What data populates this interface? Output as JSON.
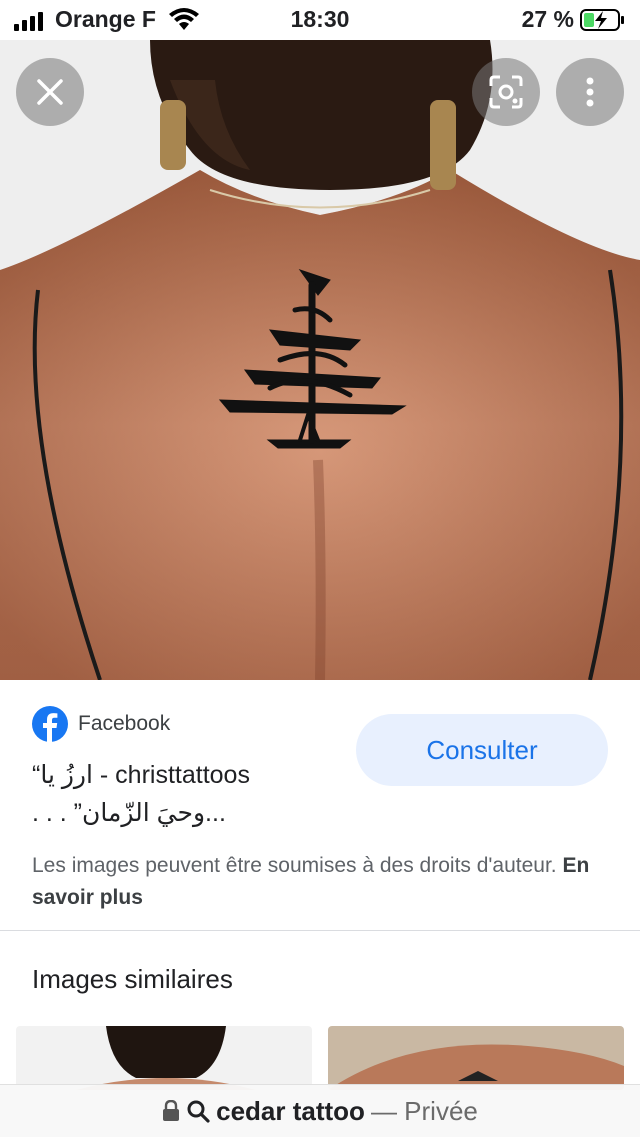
{
  "status_bar": {
    "carrier": "Orange F",
    "time": "18:30",
    "battery_percent": "27 %"
  },
  "viewer": {
    "close_icon": "close-icon",
    "lens_icon": "lens-icon",
    "more_icon": "more-vertical-icon"
  },
  "result": {
    "source": "Facebook",
    "title_line1": "“ارزُ يا - christtattoos",
    "title_line2": ". . . ”وحيَ الزّمان...",
    "consult_label": "Consulter",
    "copyright_text": "Les images peuvent être soumises à des droits d'auteur.",
    "learn_more": "En savoir plus"
  },
  "similar": {
    "heading": "Images similaires"
  },
  "address_bar": {
    "query": "cedar tattoo",
    "mode": "— Privée"
  },
  "colors": {
    "accent": "#1a73e8",
    "button_bg": "#e8f0fe",
    "facebook_blue": "#1877f2"
  }
}
